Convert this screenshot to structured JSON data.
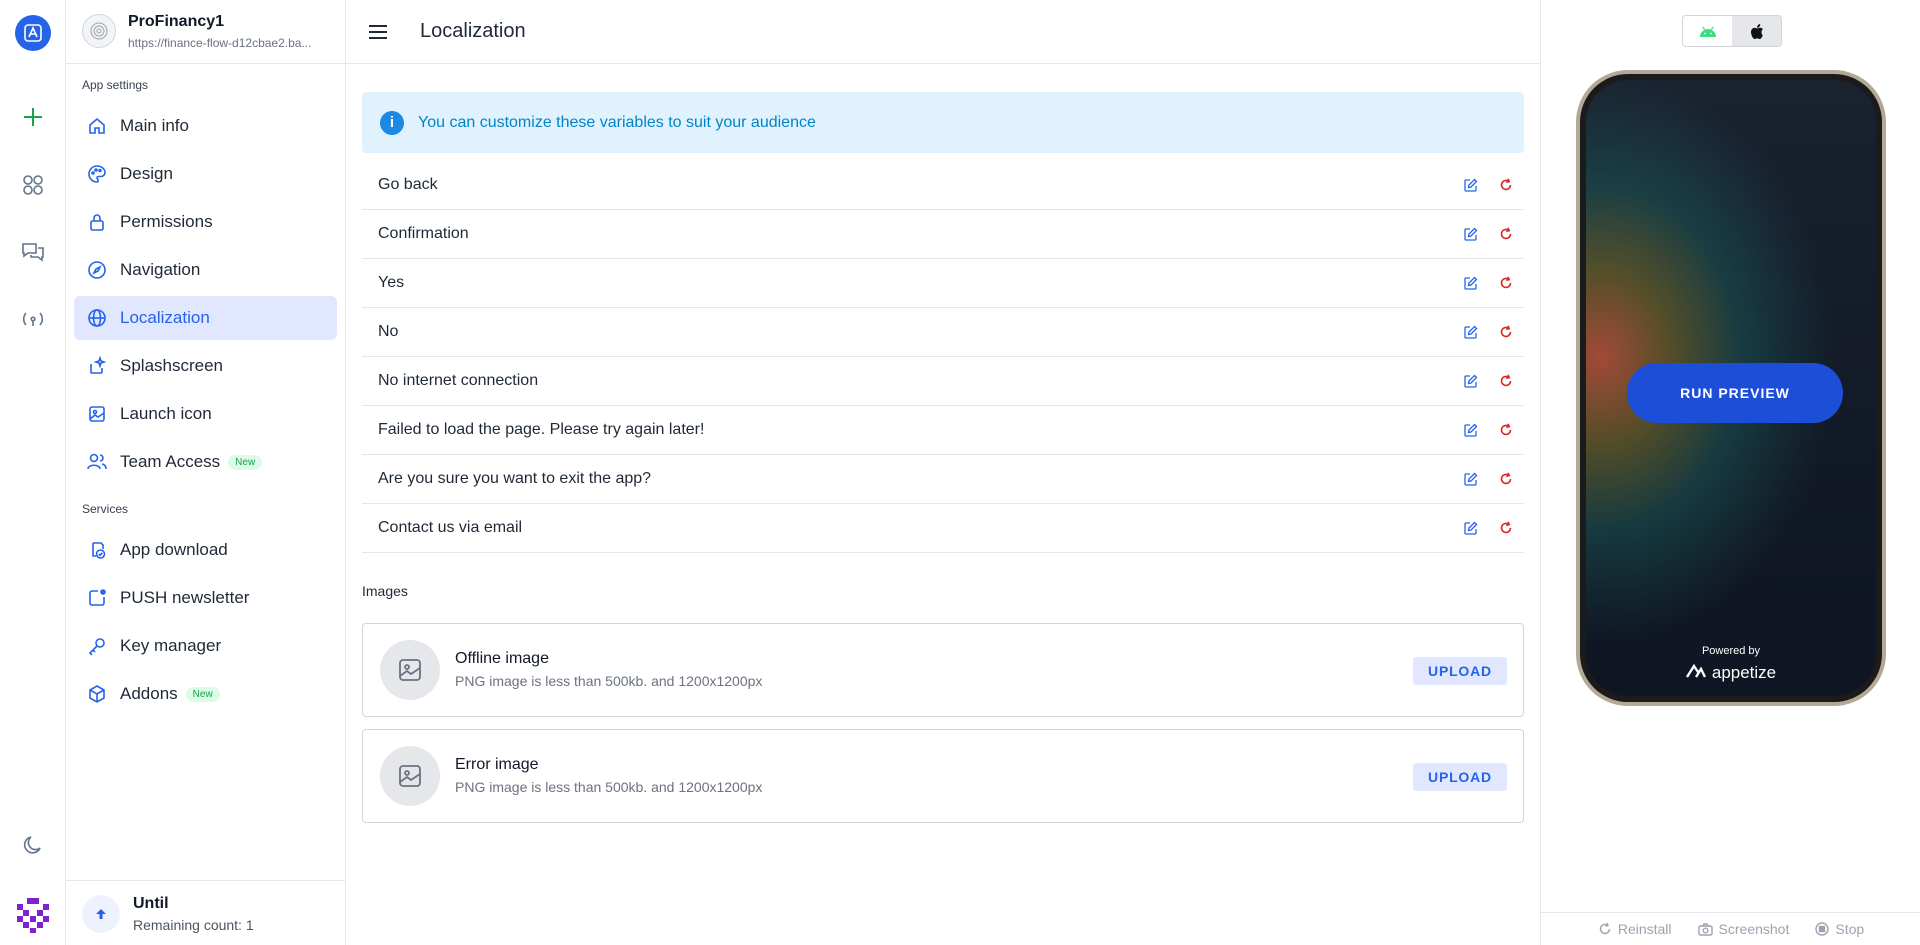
{
  "project": {
    "name": "ProFinancy1",
    "url": "https://finance-flow-d12cbae2.ba..."
  },
  "sidebar": {
    "app_settings_label": "App settings",
    "services_label": "Services",
    "items": [
      {
        "label": "Main info"
      },
      {
        "label": "Design"
      },
      {
        "label": "Permissions"
      },
      {
        "label": "Navigation"
      },
      {
        "label": "Localization"
      },
      {
        "label": "Splashscreen"
      },
      {
        "label": "Launch icon"
      },
      {
        "label": "Team Access",
        "badge": "New"
      }
    ],
    "services": [
      {
        "label": "App download"
      },
      {
        "label": "PUSH newsletter"
      },
      {
        "label": "Key manager"
      },
      {
        "label": "Addons",
        "badge": "New"
      }
    ],
    "footer": {
      "title": "Until",
      "count": "Remaining count: 1"
    }
  },
  "header": {
    "title": "Localization"
  },
  "info": {
    "text": "You can customize these variables to suit your audience"
  },
  "variables": [
    "Go back",
    "Confirmation",
    "Yes",
    "No",
    "No internet connection",
    "Failed to load the page. Please try again later!",
    "Are you sure you want to exit the app?",
    "Contact us via email"
  ],
  "images": {
    "heading": "Images",
    "items": [
      {
        "title": "Offline image",
        "subtitle": "PNG image is less than 500kb. and 1200x1200px",
        "button": "UPLOAD"
      },
      {
        "title": "Error image",
        "subtitle": "PNG image is less than 500kb. and 1200x1200px",
        "button": "UPLOAD"
      }
    ]
  },
  "preview": {
    "run_label": "RUN PREVIEW",
    "powered_by": "Powered by",
    "brand": "appetize",
    "footer": {
      "reinstall": "Reinstall",
      "screenshot": "Screenshot",
      "stop": "Stop"
    }
  },
  "colors": {
    "accent": "#2563eb",
    "active_bg": "#e0e7ff",
    "info_bg": "#e0f2fe",
    "reset": "#dc2626",
    "android": "#3ddc84"
  }
}
